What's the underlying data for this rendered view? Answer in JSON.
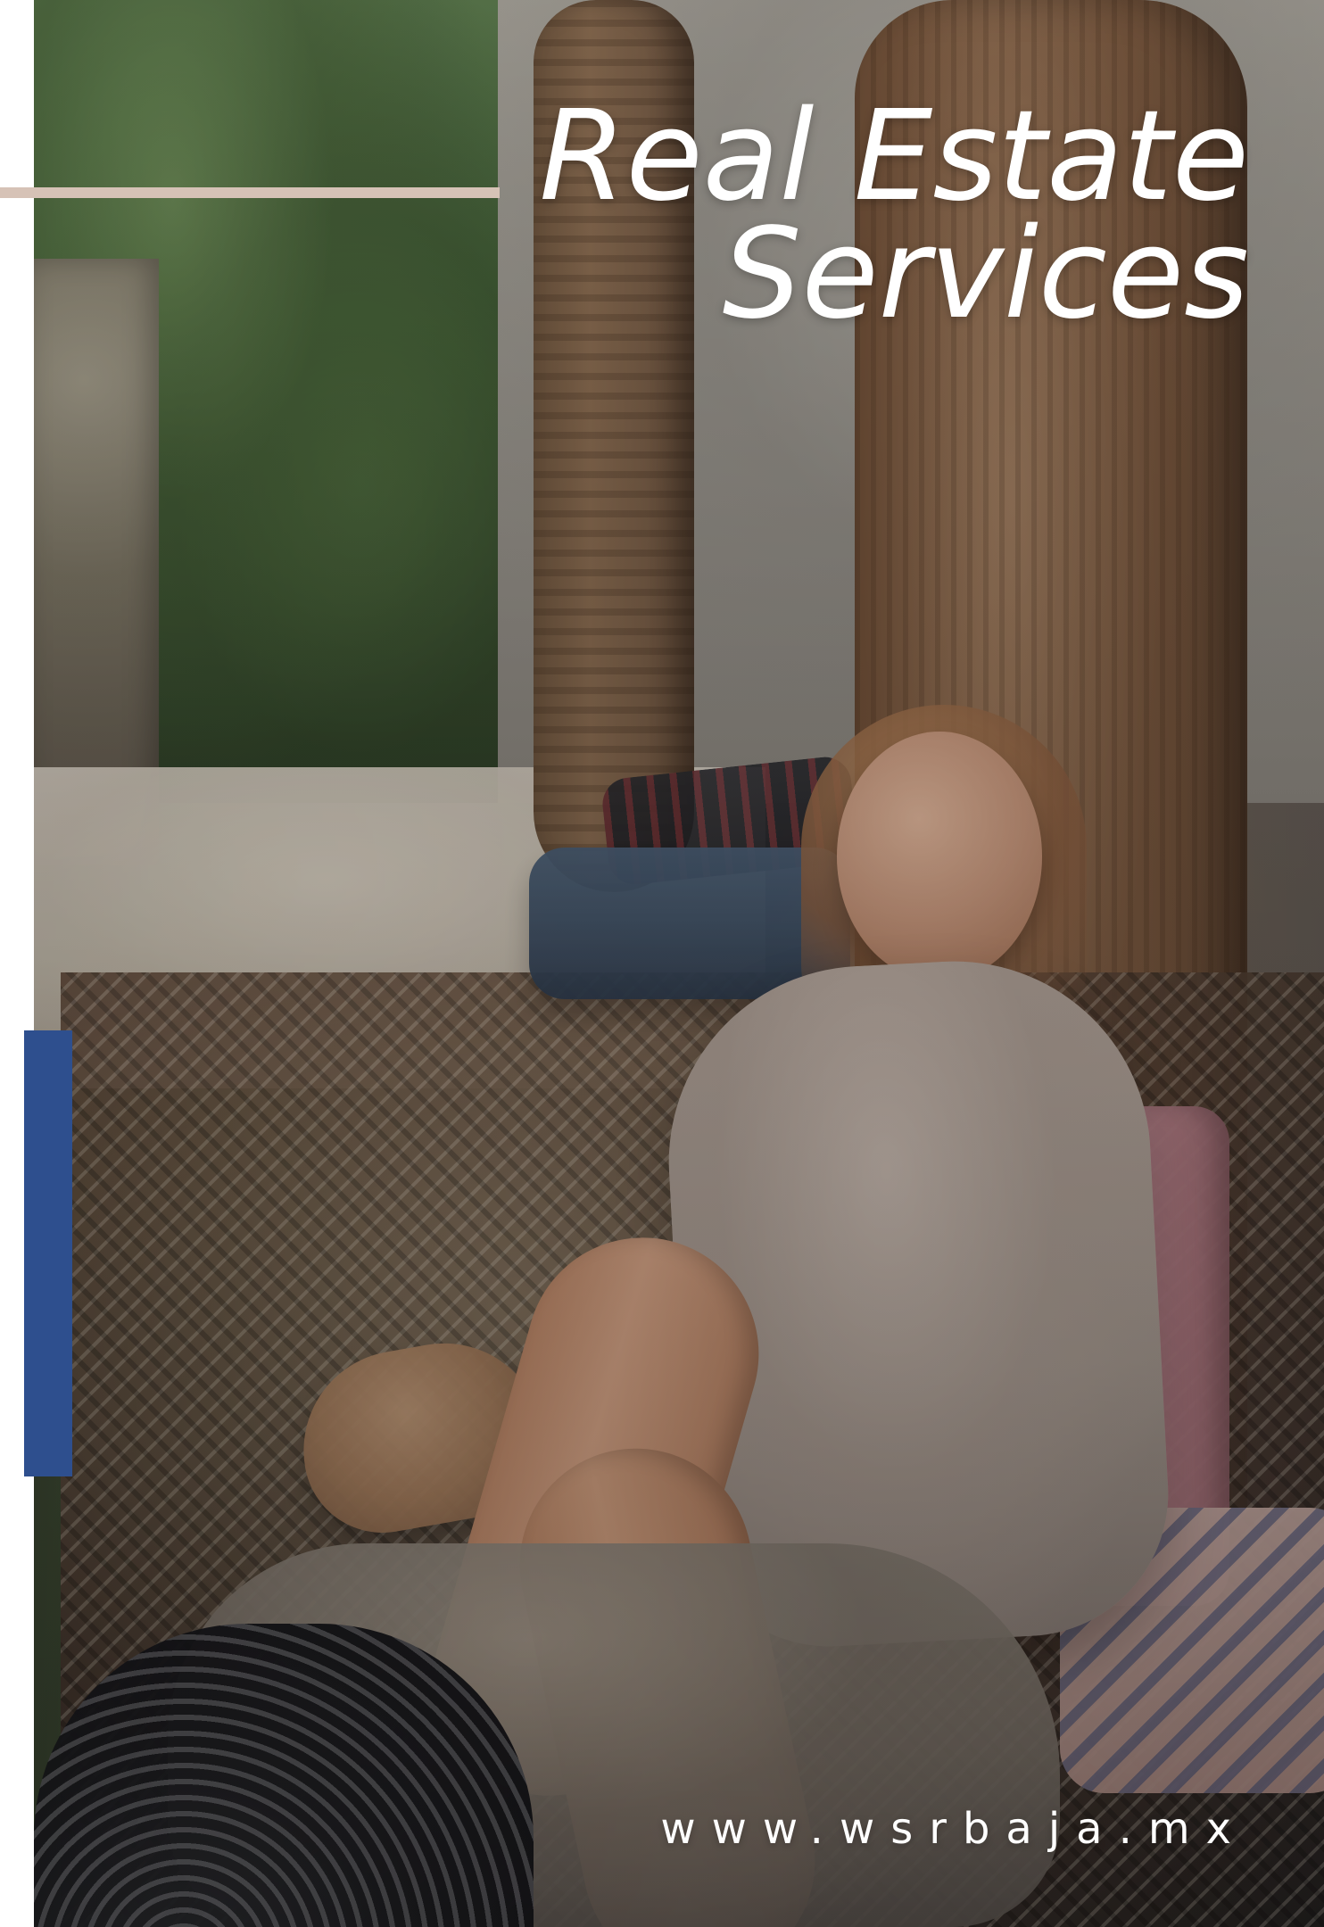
{
  "poster": {
    "title_lines": [
      "Real Estate",
      "Services"
    ],
    "website": "www.wsrbaja.mx"
  },
  "colors": {
    "top_accent_line": "#d6c2b6",
    "left_accent_bar": "#2e4f8e",
    "text": "#ffffff"
  },
  "icons": []
}
